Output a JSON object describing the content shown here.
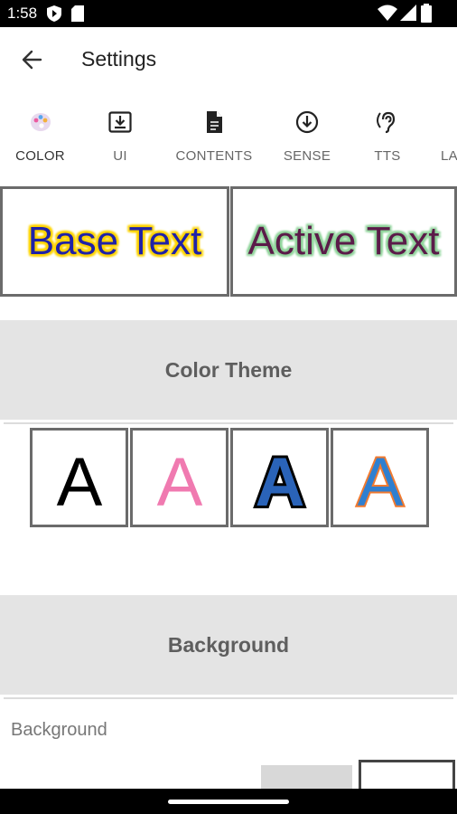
{
  "status_bar": {
    "time": "1:58",
    "icons": [
      "play-protect-icon",
      "sd-card-icon",
      "wifi-icon",
      "signal-icon",
      "battery-icon"
    ]
  },
  "app_bar": {
    "back_icon": "arrow-left-icon",
    "title": "Settings"
  },
  "tabs": [
    {
      "label": "COLOR",
      "icon": "palette-icon",
      "active": true
    },
    {
      "label": "UI",
      "icon": "download-box-icon",
      "active": false
    },
    {
      "label": "CONTENTS",
      "icon": "document-icon",
      "active": false
    },
    {
      "label": "SENSE",
      "icon": "arrow-down-circle-icon",
      "active": false
    },
    {
      "label": "TTS",
      "icon": "hearing-icon",
      "active": false
    },
    {
      "label": "LA",
      "icon": "",
      "active": false
    }
  ],
  "preview": {
    "base_text": "Base Text",
    "active_text": "Active Text",
    "colors": {
      "base_fill": "#1f22a8",
      "base_outline": "#ffd400",
      "active_fill": "#5b1b49",
      "active_outline": "#8fd49a"
    }
  },
  "color_theme": {
    "header": "Color Theme",
    "tiles": [
      {
        "glyph": "A",
        "fill": "#000000",
        "outline": "none"
      },
      {
        "glyph": "A",
        "fill": "#f07ab0",
        "outline": "none"
      },
      {
        "glyph": "A",
        "fill": "#2a63b8",
        "outline": "#000000"
      },
      {
        "glyph": "A",
        "fill": "#2f7fd0",
        "outline": "#f07a30"
      }
    ]
  },
  "background": {
    "header": "Background",
    "label": "Background"
  }
}
